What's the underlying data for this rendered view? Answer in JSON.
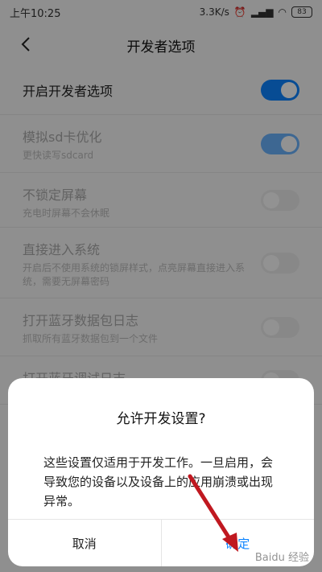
{
  "status": {
    "time": "上午10:25",
    "speed": "3.3K/s",
    "battery": "83"
  },
  "title": "开发者选项",
  "rows": [
    {
      "title": "开启开发者选项",
      "sub": "",
      "on": true
    },
    {
      "title": "模拟sd卡优化",
      "sub": "更快读写sdcard",
      "on": true
    },
    {
      "title": "不锁定屏幕",
      "sub": "充电时屏幕不会休眠",
      "on": false
    },
    {
      "title": "直接进入系统",
      "sub": "开启后不使用系统的锁屏样式，点亮屏幕直接进入系统，需要无屏幕密码",
      "on": false
    },
    {
      "title": "打开蓝牙数据包日志",
      "sub": "抓取所有蓝牙数据包到一个文件",
      "on": false
    },
    {
      "title": "打开蓝牙调试日志",
      "sub": "",
      "on": false
    }
  ],
  "dialog": {
    "title": "允许开发设置?",
    "message": "这些设置仅适用于开发工作。一旦启用，会导致您的设备以及设备上的应用崩溃或出现异常。",
    "cancel": "取消",
    "ok": "确定"
  },
  "watermark": "Baidu 经验",
  "colors": {
    "accent": "#0d84ff",
    "arrow": "#c01820"
  }
}
